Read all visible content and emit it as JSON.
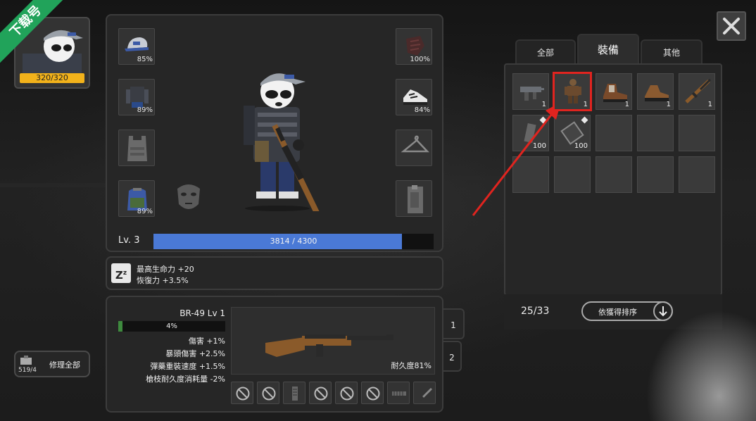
{
  "watermark": {
    "text": "下载号",
    "color": "#21a35a"
  },
  "player": {
    "hp_text": "320/320",
    "hp_fraction": 1.0
  },
  "equipment": {
    "slots": [
      {
        "name": "cap",
        "percent": "85%"
      },
      {
        "name": "jacket",
        "percent": "89%"
      },
      {
        "name": "vest",
        "percent": ""
      },
      {
        "name": "backpack",
        "percent": "89%"
      },
      {
        "name": "gloves",
        "percent": "100%"
      },
      {
        "name": "shoes",
        "percent": "84%"
      },
      {
        "name": "hanger",
        "percent": ""
      },
      {
        "name": "holster",
        "percent": ""
      }
    ],
    "level_label": "Lv. 3",
    "xp_text": "3814 / 4300",
    "xp_fraction": 0.887
  },
  "buff": {
    "icon": "sleep-icon",
    "line1": "最高生命力 +20",
    "line2": "恢復力 +3.5%"
  },
  "weapon": {
    "name": "BR-49 Lv 1",
    "progress_text": "4%",
    "progress_fraction": 0.04,
    "stats": [
      "傷害 +1%",
      "暴頭傷害 +2.5%",
      "彈藥重裝速度 +1.5%",
      "槍枝耐久度消耗量 -2%"
    ],
    "durability": "耐久度81%",
    "side_tabs": [
      "1",
      "2"
    ]
  },
  "repair": {
    "count": "519/4",
    "label": "修理全部"
  },
  "inventory": {
    "tabs": [
      "全部",
      "裝備",
      "其他"
    ],
    "active_tab": 1,
    "items": [
      {
        "icon": "smg-icon",
        "count": "1"
      },
      {
        "icon": "camo-suit-icon",
        "count": "1",
        "highlighted": true
      },
      {
        "icon": "boots-icon",
        "count": "1"
      },
      {
        "icon": "hiking-boots-icon",
        "count": "1"
      },
      {
        "icon": "rifle-icon",
        "count": "1"
      },
      {
        "icon": "magazine-icon",
        "count": "100",
        "new": true
      },
      {
        "icon": "ammo-box-icon",
        "count": "100",
        "new": true
      }
    ],
    "capacity": "25/33",
    "sort_label": "依獲得排序"
  },
  "colors": {
    "accent_blue": "#4a79d6",
    "hp_yellow": "#f2b21b",
    "highlight_red": "#e0241f"
  }
}
